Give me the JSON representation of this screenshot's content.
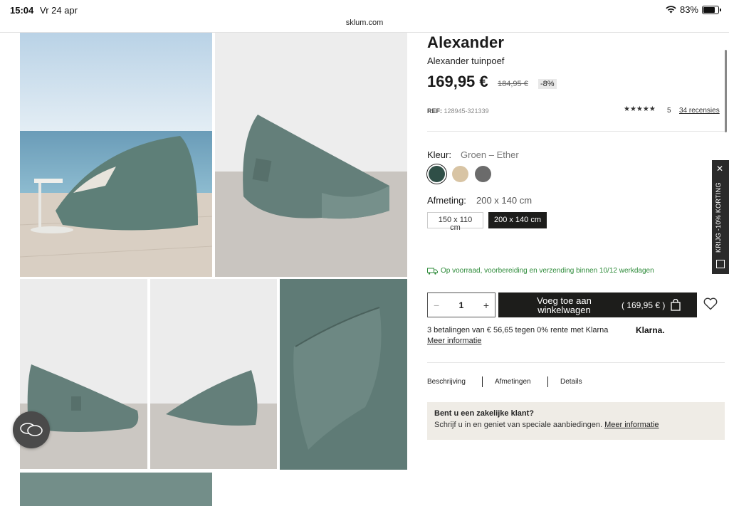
{
  "status_bar": {
    "time": "15:04",
    "date": "Vr 24 apr",
    "battery": "83%"
  },
  "browser": {
    "url": "sklum.com"
  },
  "product": {
    "name": "Alexander",
    "subtitle": "Alexander tuinpoef",
    "price": "169,95 €",
    "old_price": "184,95 €",
    "discount": "-8%",
    "ref_label": "REF:",
    "ref": "128945-321339",
    "stars": "★★★★★",
    "rating": "5",
    "reviews": "34 recensies"
  },
  "color": {
    "label": "Kleur:",
    "value": "Groen – Ether",
    "swatches": [
      "#2f4f47",
      "#d8c4a4",
      "#6b6b6b"
    ]
  },
  "size": {
    "label": "Afmeting:",
    "value": "200 x 140 cm",
    "options": [
      "150 x 110 cm",
      "200 x 140 cm"
    ]
  },
  "stock_text": "Op voorraad, voorbereiding en verzending binnen 10/12 werkdagen",
  "cart": {
    "quantity": "1",
    "minus": "−",
    "plus": "+",
    "add_label": "Voeg toe aan winkelwagen",
    "amount": "( 169,95 € )"
  },
  "klarna": {
    "text": "3 betalingen van € 56,65 tegen 0% rente met Klarna",
    "logo": "Klarna.",
    "more": "Meer informatie"
  },
  "tabs": [
    "Beschrijving",
    "Afmetingen",
    "Details"
  ],
  "business": {
    "title": "Bent u een zakelijke klant?",
    "text": "Schrijf u in en geniet van speciale aanbiedingen.",
    "link": "Meer informatie"
  },
  "promo": {
    "text": "KRIJG -10% KORTING",
    "close": "✕"
  },
  "colors": {
    "accent_dark": "#1d1d1b",
    "stock_green": "#2e8b3a",
    "business_bg": "#efece6"
  }
}
